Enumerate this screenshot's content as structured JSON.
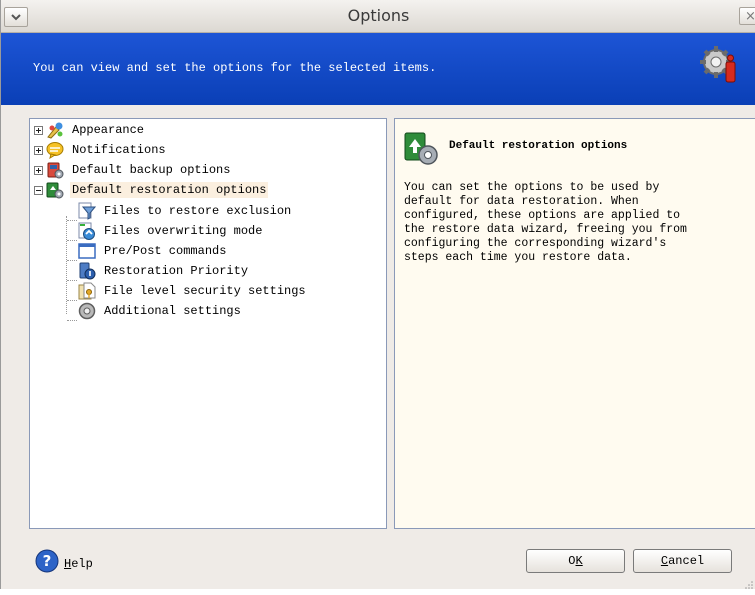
{
  "window": {
    "title": "Options",
    "close_glyph": "×",
    "menu_icon": "chevron-down-icon"
  },
  "header": {
    "text": "You can view and set the options for the selected items.",
    "icon": "gear-options-icon",
    "background": "#0f45c4"
  },
  "tree": {
    "items": [
      {
        "label": "Appearance",
        "icon": "appearance-icon",
        "expander": "plus"
      },
      {
        "label": "Notifications",
        "icon": "notifications-icon",
        "expander": "plus"
      },
      {
        "label": "Default backup options",
        "icon": "backup-options-icon",
        "expander": "plus"
      },
      {
        "label": "Default restoration options",
        "icon": "restoration-options-icon",
        "expander": "minus",
        "selected": true
      },
      {
        "label": "Files to restore exclusion",
        "icon": "filter-icon"
      },
      {
        "label": "Files overwriting mode",
        "icon": "overwrite-icon"
      },
      {
        "label": "Pre/Post commands",
        "icon": "commands-icon"
      },
      {
        "label": "Restoration Priority",
        "icon": "priority-icon"
      },
      {
        "label": "File level security settings",
        "icon": "security-icon"
      },
      {
        "label": "Additional settings",
        "icon": "additional-settings-icon"
      }
    ]
  },
  "description": {
    "title": "Default restoration options",
    "icon": "restoration-options-icon",
    "body": "You can set the options to be used by\ndefault for data restoration. When\nconfigured, these options are applied to\nthe restore data wizard, freeing you from\nconfiguring the corresponding wizard's\nsteps each time you restore data."
  },
  "footer": {
    "help": {
      "mnemonic": "H",
      "rest": "elp",
      "icon": "help-icon"
    },
    "ok": {
      "mnemonic": "K",
      "before": "O",
      "after": ""
    },
    "cancel": {
      "mnemonic": "C",
      "before": "",
      "after": "ancel"
    }
  }
}
